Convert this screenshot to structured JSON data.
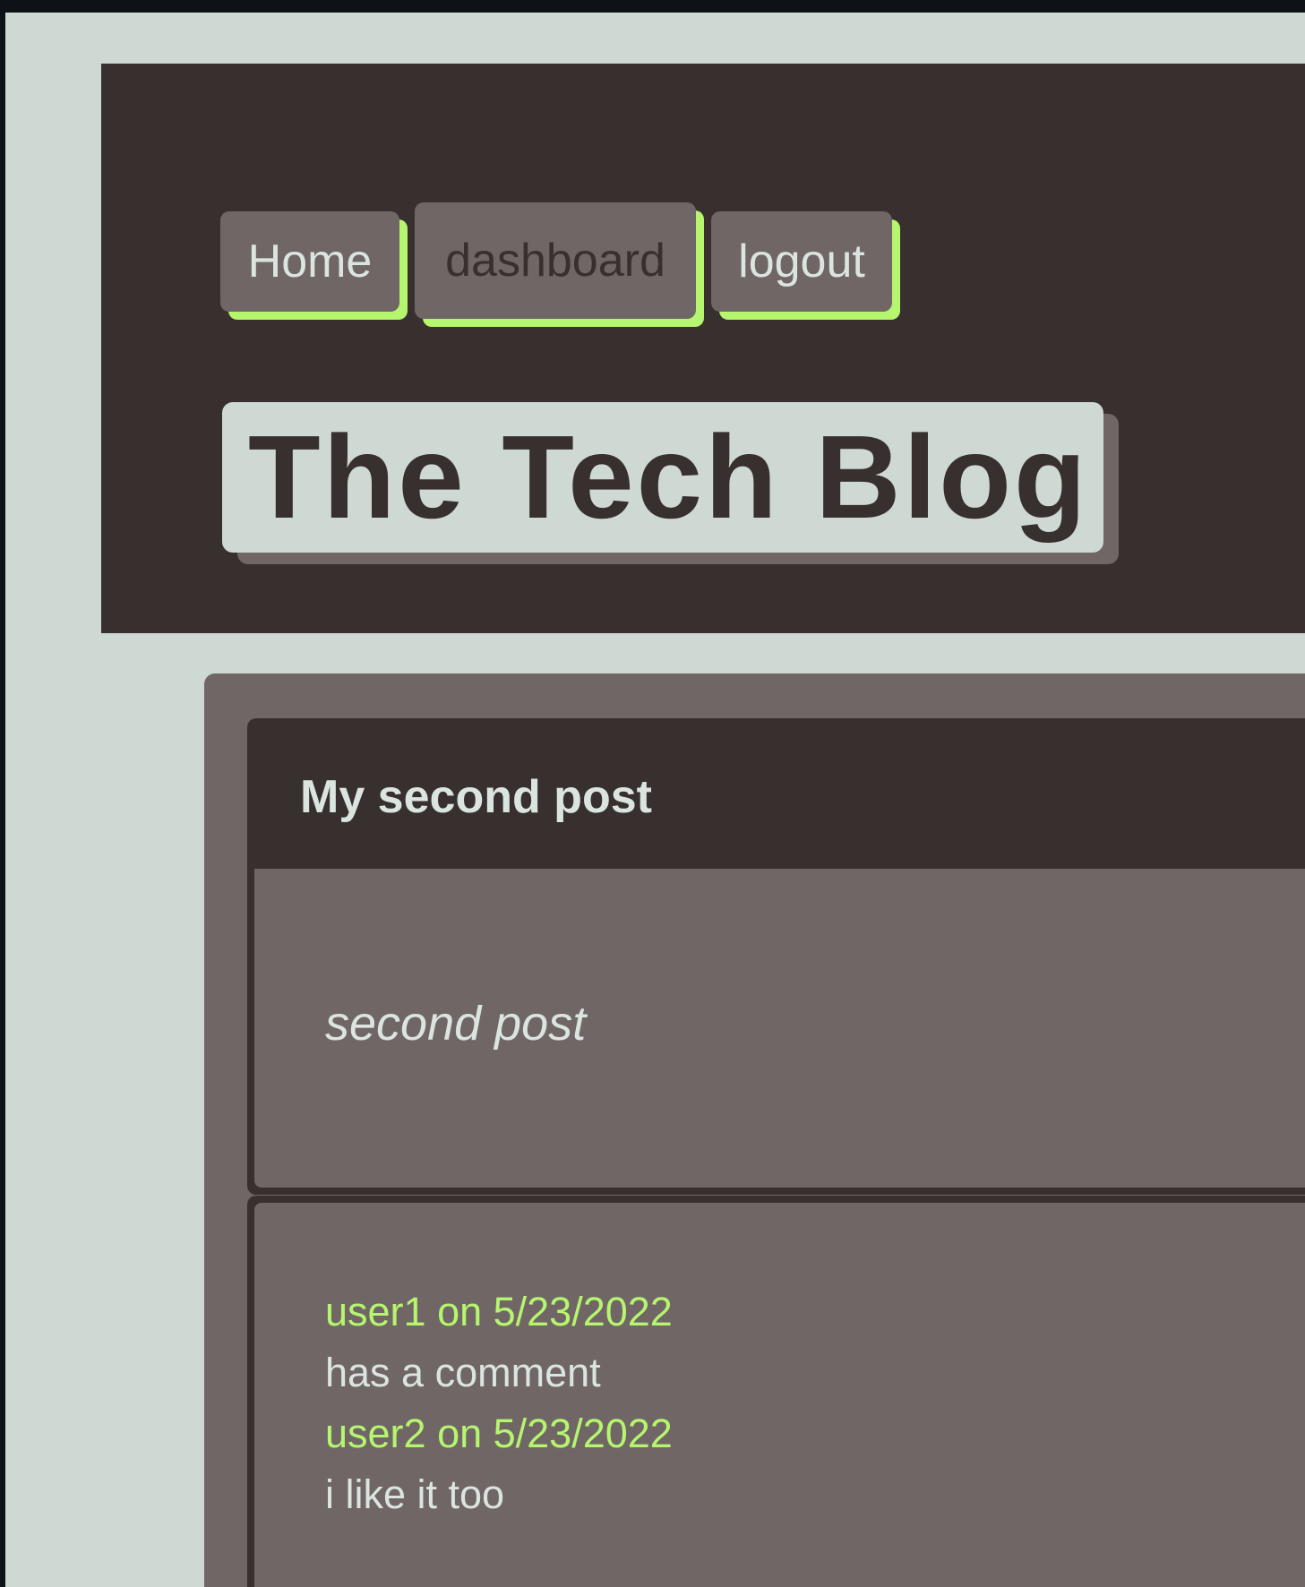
{
  "nav": {
    "home": "Home",
    "dashboard": "dashboard",
    "logout": "logout"
  },
  "site_title": "The Tech Blog",
  "post": {
    "title": "My second post",
    "body": "second post"
  },
  "comments": [
    {
      "meta": "user1 on 5/23/2022",
      "text": "has a comment"
    },
    {
      "meta": "user2 on 5/23/2022",
      "text": "i like it too"
    }
  ],
  "colors": {
    "background": "#cdd9d2",
    "header": "#382f2f",
    "card": "#706666",
    "accent": "#b6f56e",
    "text_light": "#dbe5df"
  }
}
